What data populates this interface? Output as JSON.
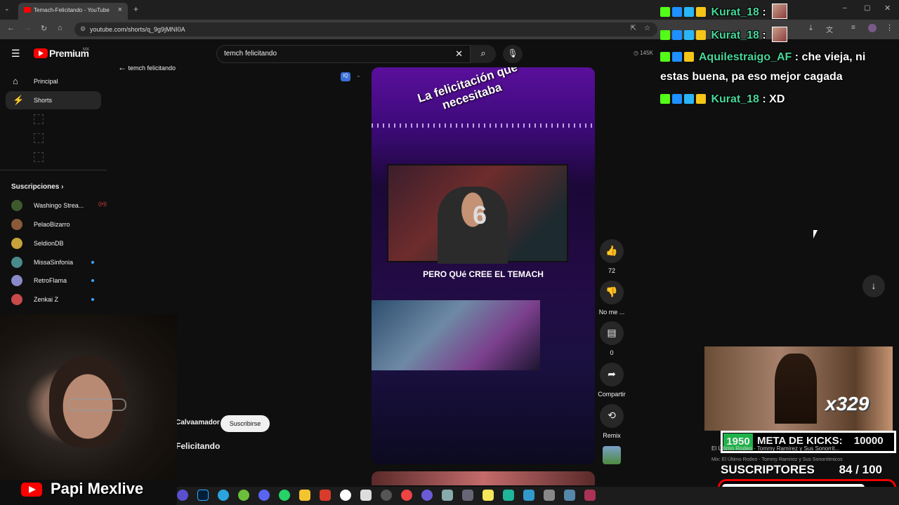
{
  "browser": {
    "tab_title": "Temach-Felicitando - YouTube",
    "url": "youtube.com/shorts/q_9g9jMNI0A"
  },
  "youtube": {
    "logo_text": "Premium",
    "logo_region": "MX",
    "search_value": "temch felicitando",
    "back_label": "temch felicitando",
    "stat_views": "145K",
    "nav": [
      {
        "label": "Principal",
        "icon": "home-icon"
      },
      {
        "label": "Shorts",
        "icon": "shorts-icon",
        "active": true
      }
    ],
    "subscriptions_header": "Suscripciones",
    "subscriptions": [
      {
        "name": "Washingo Strea...",
        "live": true,
        "color": "#3c5a2c"
      },
      {
        "name": "PelaoBizarro",
        "color": "#8a5a3a"
      },
      {
        "name": "SeldionDB",
        "color": "#c8a23a"
      },
      {
        "name": "MissaSinfonia",
        "new": true,
        "color": "#4a8a8a"
      },
      {
        "name": "RetroFlama",
        "new": true,
        "color": "#8a8ac8"
      },
      {
        "name": "Zenkai Z",
        "new": true,
        "color": "#c84a4a"
      }
    ]
  },
  "short": {
    "overlay_title": "La felicitación que necesitaba",
    "caption": "PERO QUé CREE EL TEMACH",
    "channel": "Calvaamador",
    "subscribe_label": "Suscribirse",
    "title": "Felicitando",
    "actions": {
      "like_count": "72",
      "dislike_label": "No me ...",
      "comment_count": "0",
      "share_label": "Compartir",
      "remix_label": "Remix"
    }
  },
  "chat": [
    {
      "user": "Kurat_18",
      "message": ""
    },
    {
      "user": "Kurat_18",
      "message": ""
    },
    {
      "user": "Aquilestraigo_AF",
      "message": "che vieja, ni"
    },
    {
      "user": "",
      "message": "estas buena, pa eso mejor cagada"
    },
    {
      "user": "Kurat_18",
      "message": "XD"
    }
  ],
  "stream": {
    "brand": "Papi Mexlive",
    "music_multiplier": "x329",
    "meta_kicks_current": "1950",
    "meta_kicks_label": "META DE KICKS:",
    "meta_kicks_goal": "10000",
    "music_line1": "El Último Rodeo - Tommy Ramírez y Sus Sonorrit...",
    "music_line2": "Mix: El Último Rodeo - Tommy Ramírez y Sus Sonorritmicos",
    "subs_label": "SUSCRIPTORES",
    "subs_progress": "84 / 100",
    "subs_fraction": 0.84
  }
}
